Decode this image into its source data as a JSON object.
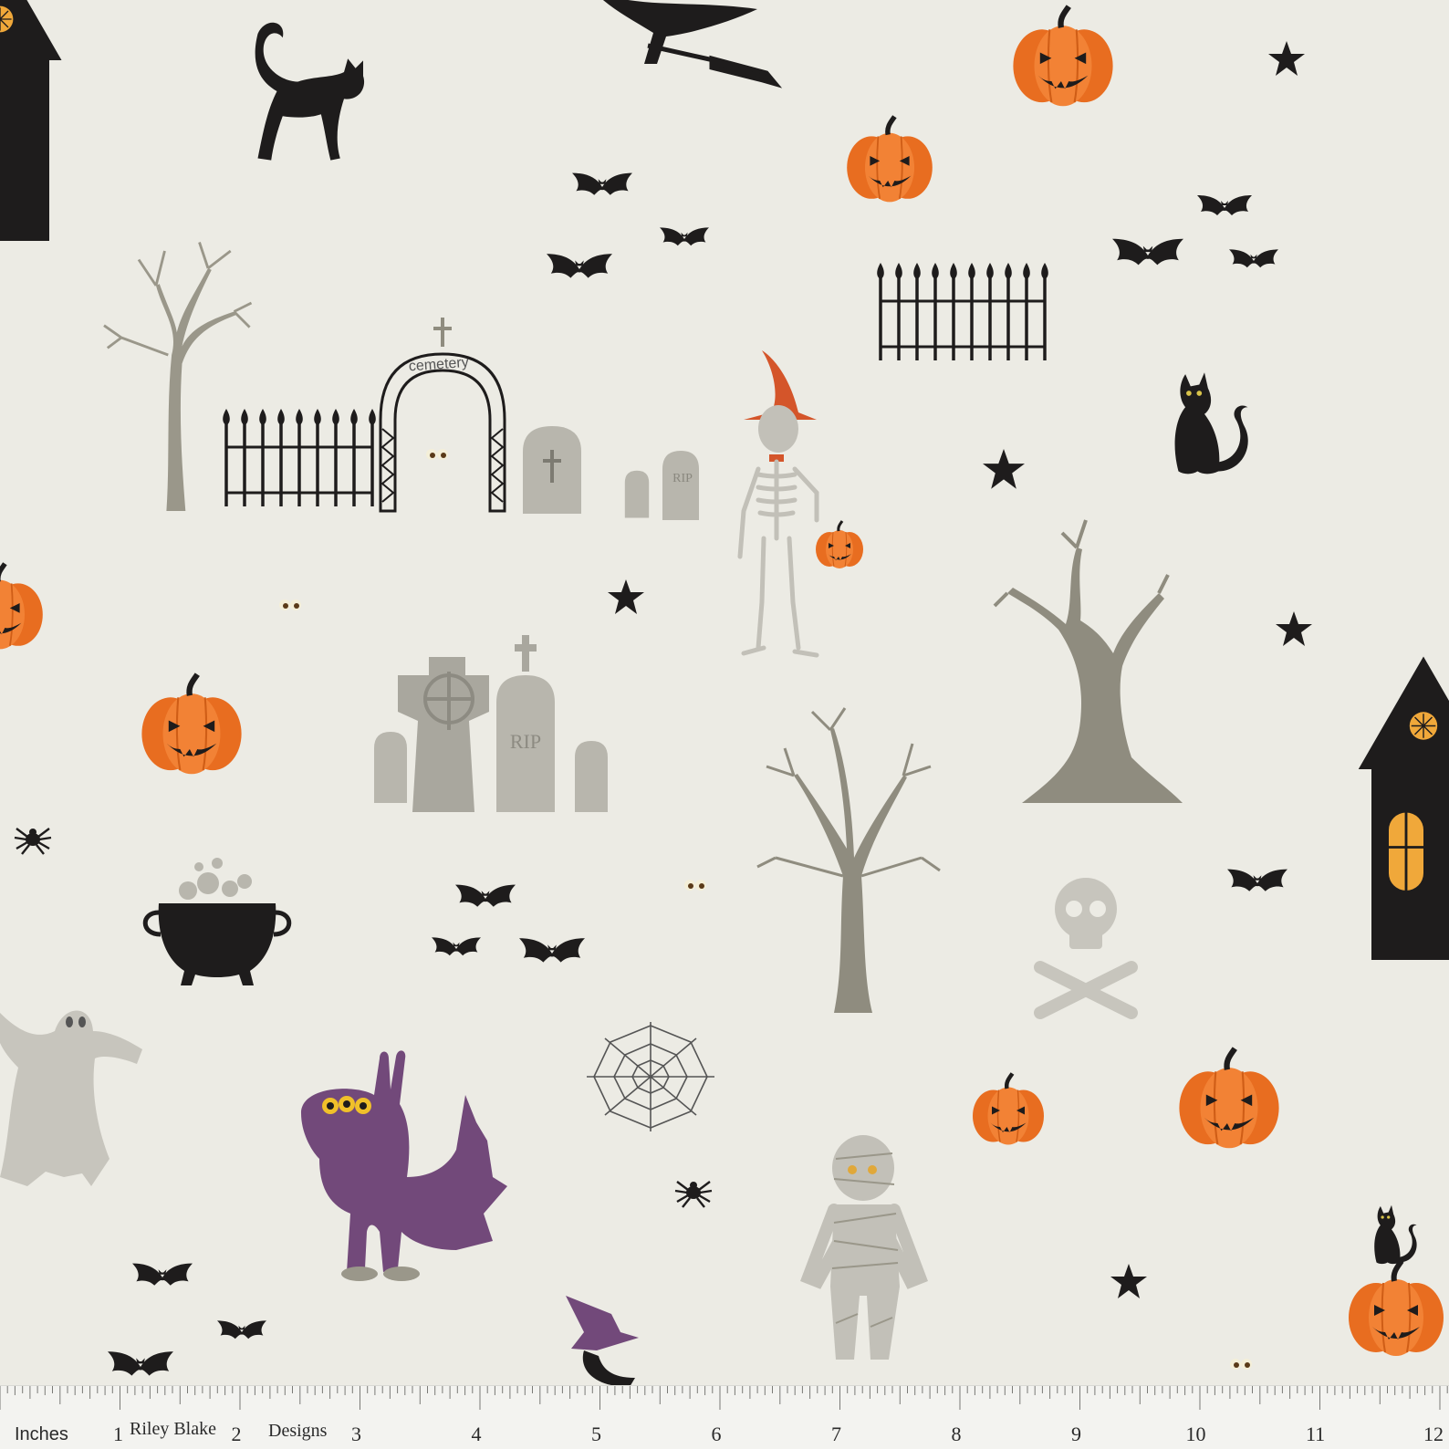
{
  "fabric": {
    "background": "#ecebe4",
    "palette": {
      "black": "#1e1c1c",
      "orange": "#ee7a2a",
      "grey": "#b8b6ad",
      "tree": "#8f8c7f",
      "purple": "#72497a",
      "window": "#f0a83a"
    },
    "motifs": [
      "haunted-house",
      "black-cat",
      "witch-on-broom",
      "jack-o-lantern",
      "bat",
      "star",
      "bare-tree",
      "cemetery-gate",
      "tombstone",
      "skeleton",
      "cauldron",
      "ghost",
      "monster",
      "mummy",
      "spider",
      "spider-web",
      "skull-and-crossbones",
      "glowing-eyes",
      "witch-hat"
    ]
  },
  "gate_sign": "cemetery",
  "tombstones": {
    "small": "RIP",
    "large": "RIP"
  },
  "ruler": {
    "unit_label": "Inches",
    "brand_left": "Riley Blake",
    "brand_right": "Designs",
    "numbers": [
      "1",
      "2",
      "3",
      "4",
      "5",
      "6",
      "7",
      "8",
      "9",
      "10",
      "11",
      "12"
    ]
  }
}
